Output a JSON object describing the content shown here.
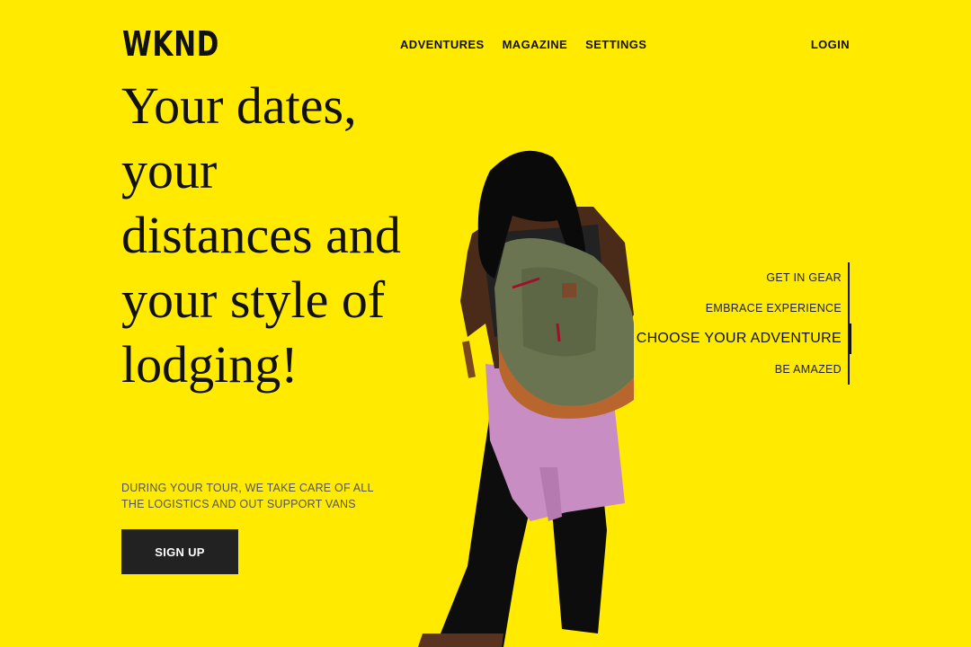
{
  "brand": {
    "logo": "WKND"
  },
  "nav": {
    "items": [
      "ADVENTURES",
      "MAGAZINE",
      "SETTINGS"
    ],
    "login": "LOGIN"
  },
  "hero": {
    "title": "Your dates, your distances and your style of lodging!",
    "subtitle": "DURING YOUR TOUR, WE TAKE CARE OF ALL THE LOGISTICS AND OUT SUPPORT VANS",
    "cta": "SIGN UP"
  },
  "steps": {
    "items": [
      "GET IN GEAR",
      "EMBRACE EXPERIENCE",
      "CHOOSE YOUR ADVENTURE",
      "BE AMAZED"
    ],
    "active_index": 2
  },
  "colors": {
    "background": "#ffea00",
    "text": "#111111",
    "button_bg": "#222222",
    "button_text": "#ffffff"
  },
  "image": {
    "icon": "hiker-with-backpack"
  }
}
